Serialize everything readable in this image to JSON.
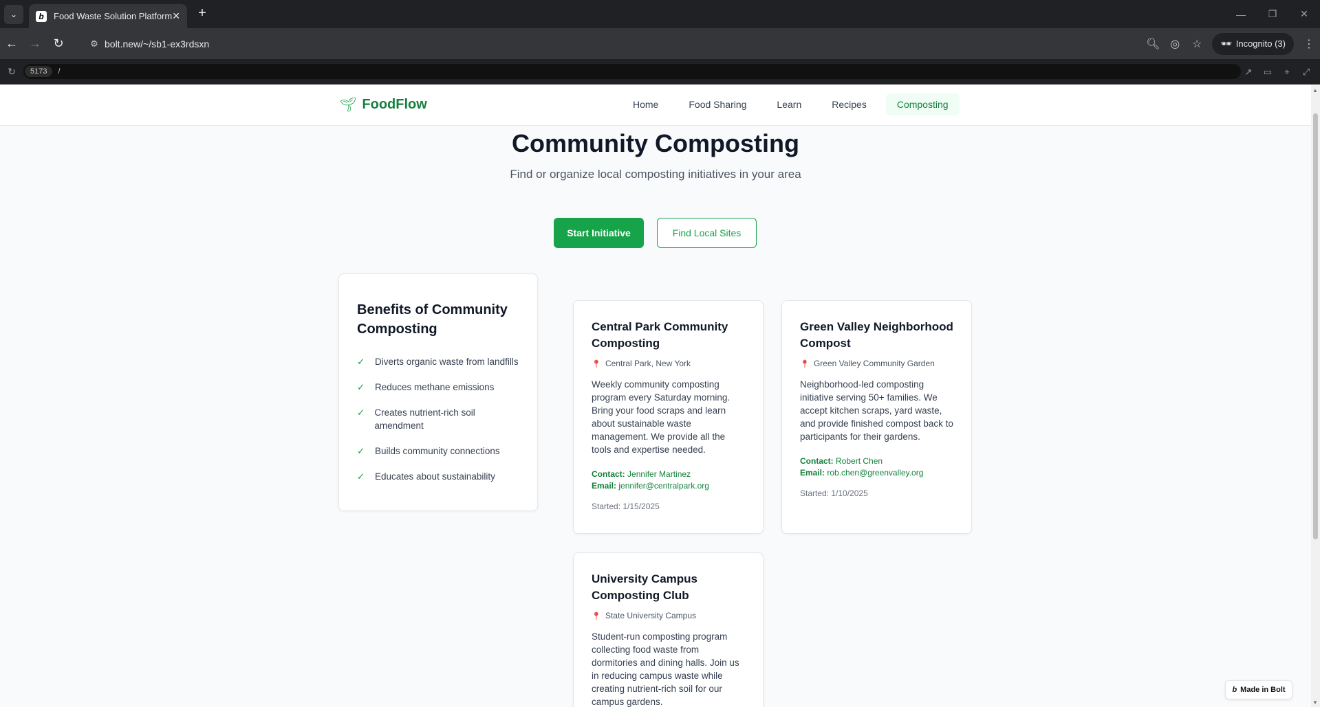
{
  "browser": {
    "tab_title": "Food Waste Solution Platform",
    "favicon_letter": "b",
    "url": "bolt.new/~/sb1-ex3rdsxn",
    "incognito_label": "Incognito (3)"
  },
  "devbar": {
    "port": "5173",
    "path": "/"
  },
  "nav": {
    "brand": "FoodFlow",
    "links": [
      {
        "label": "Home",
        "active": false
      },
      {
        "label": "Food Sharing",
        "active": false
      },
      {
        "label": "Learn",
        "active": false
      },
      {
        "label": "Recipes",
        "active": false
      },
      {
        "label": "Composting",
        "active": true
      }
    ]
  },
  "hero": {
    "title": "Community Composting",
    "subtitle": "Find or organize local composting initiatives in your area",
    "primary_button": "Start Initiative",
    "secondary_button": "Find Local Sites"
  },
  "benefits": {
    "title": "Benefits of Community Composting",
    "items": [
      "Diverts organic waste from landfills",
      "Reduces methane emissions",
      "Creates nutrient-rich soil amendment",
      "Builds community connections",
      "Educates about sustainability"
    ]
  },
  "sites": [
    {
      "title": "Central Park Community Composting",
      "location": "Central Park, New York",
      "description": "Weekly community composting program every Saturday morning. Bring your food scraps and learn about sustainable waste management. We provide all the tools and expertise needed.",
      "contact_label": "Contact:",
      "contact": "Jennifer Martinez",
      "email_label": "Email:",
      "email": "jennifer@centralpark.org",
      "started": "Started: 1/15/2025"
    },
    {
      "title": "Green Valley Neighborhood Compost",
      "location": "Green Valley Community Garden",
      "description": "Neighborhood-led composting initiative serving 50+ families. We accept kitchen scraps, yard waste, and provide finished compost back to participants for their gardens.",
      "contact_label": "Contact:",
      "contact": "Robert Chen",
      "email_label": "Email:",
      "email": "rob.chen@greenvalley.org",
      "started": "Started: 1/10/2025"
    },
    {
      "title": "University Campus Composting Club",
      "location": "State University Campus",
      "description": "Student-run composting program collecting food waste from dormitories and dining halls. Join us in reducing campus waste while creating nutrient-rich soil for our campus gardens."
    }
  ],
  "badge": "Made in Bolt",
  "colors": {
    "primary": "#16a34a",
    "primary_dark": "#15803d",
    "active_bg": "#f0fdf4"
  },
  "icons": {
    "brand": "seedling-icon",
    "location": "pin-icon",
    "check": "check-icon"
  }
}
